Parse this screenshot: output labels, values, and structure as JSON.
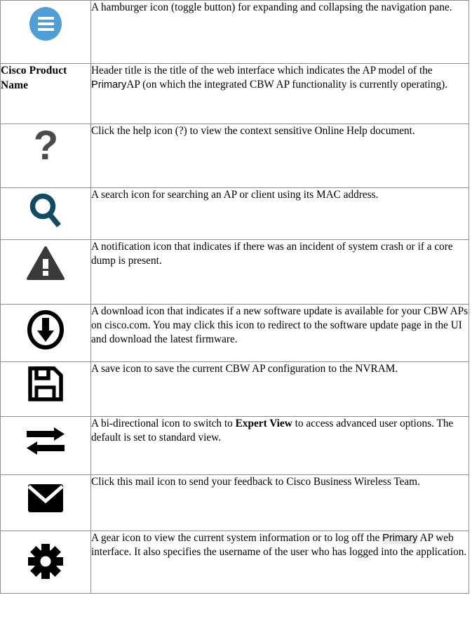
{
  "document": {
    "type": "icon-legend-table",
    "columns": 3,
    "border_color": "#8e8e8e"
  },
  "rows": [
    {
      "icon": "hamburger-menu-icon",
      "icon_color": "#4d9fd6",
      "label": "",
      "description": "A hamburger icon (toggle button) for expanding and collapsing the navigation pane."
    },
    {
      "icon": "",
      "label": "Cisco Product Name",
      "description_pre": "Header title is the title of the web interface which indicates the AP model of the ",
      "description_sans": "Primary",
      "description_post": "AP (on which the integrated CBW AP functionality is currently operating)."
    },
    {
      "icon": "help-question-icon",
      "icon_color": "#4a4a4a",
      "label": "",
      "description": "Click the help icon (?) to view the context sensitive Online Help document."
    },
    {
      "icon": "search-magnifier-icon",
      "icon_color": "#0f4c64",
      "label": "",
      "description": "A search icon for searching an AP or client using its MAC address."
    },
    {
      "icon": "notification-warning-icon",
      "icon_color": "#3a3a3a",
      "label": "",
      "description": "A notification icon that indicates if there was an incident of system crash or if a core dump is present."
    },
    {
      "icon": "download-arrow-icon",
      "icon_color": "#000000",
      "label": "",
      "description": "A download icon that indicates if a new software update is available for your CBW APs on cisco.com. You may click this icon to redirect to the software update page in the UI and download the latest firmware."
    },
    {
      "icon": "save-floppy-icon",
      "icon_color": "#000000",
      "label": "",
      "description": "A save icon to save the current CBW AP configuration to the NVRAM."
    },
    {
      "icon": "bidirectional-arrows-icon",
      "icon_color": "#000000",
      "label": "",
      "description_pre": "A bi-directional icon to switch to ",
      "description_bold": "Expert View",
      "description_post": " to access advanced user options. The default is set to standard view."
    },
    {
      "icon": "mail-envelope-icon",
      "icon_color": "#000000",
      "label": "",
      "description": "Click this mail icon to send your feedback to Cisco Business Wireless Team."
    },
    {
      "icon": "gear-settings-icon",
      "icon_color": "#000000",
      "label": "",
      "description_pre": "A gear icon to view the current system information or to log off the ",
      "description_sans": "Primary",
      "description_post": " AP web interface. It also specifies the username of the user who has logged into the application."
    }
  ]
}
